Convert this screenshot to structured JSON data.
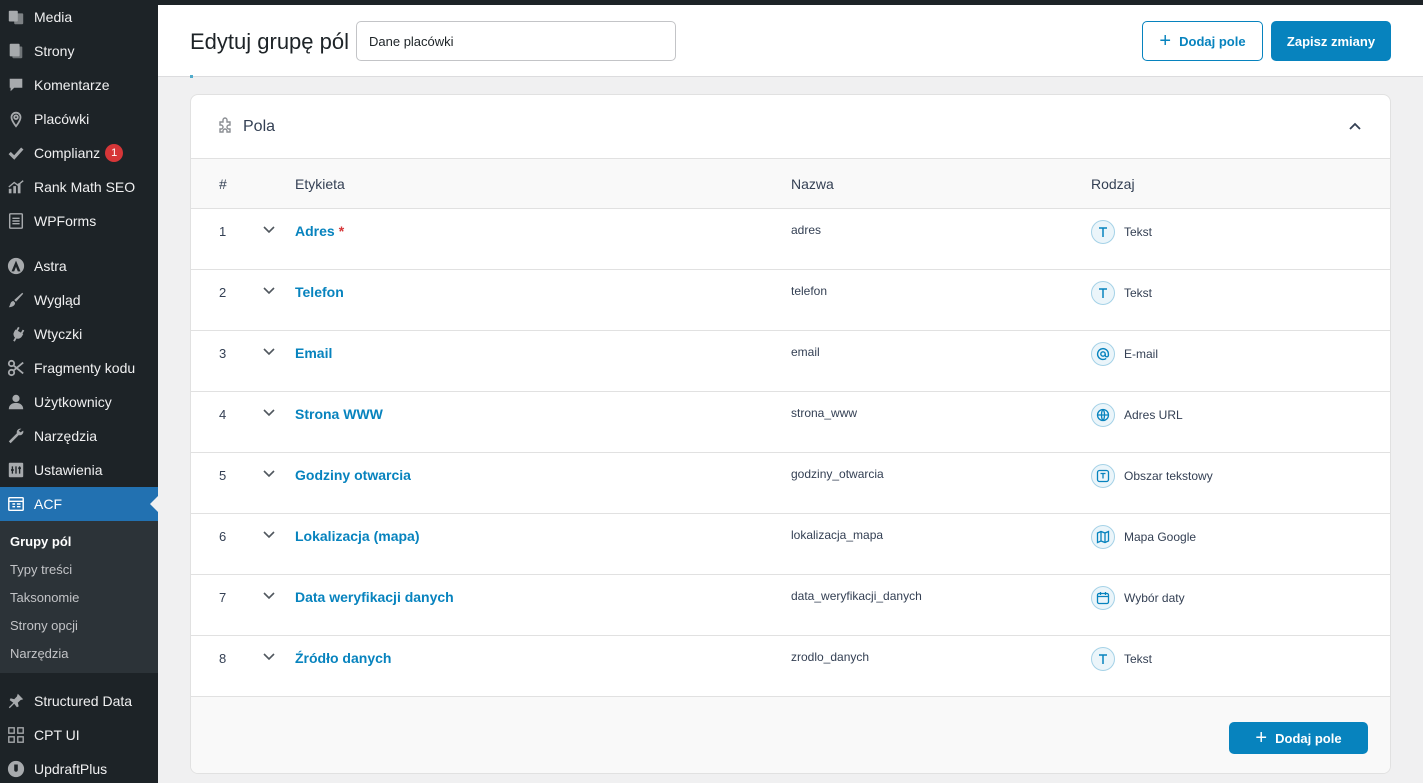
{
  "sidebar": {
    "items": [
      {
        "label": "Media",
        "icon": "media-icon"
      },
      {
        "label": "Strony",
        "icon": "pages-icon"
      },
      {
        "label": "Komentarze",
        "icon": "comments-icon"
      },
      {
        "label": "Placówki",
        "icon": "location-pin-icon"
      },
      {
        "label": "Complianz",
        "icon": "checkmark-icon",
        "badge": "1"
      },
      {
        "label": "Rank Math SEO",
        "icon": "chart-icon"
      },
      {
        "label": "WPForms",
        "icon": "forms-icon"
      },
      {
        "label": "Astra",
        "icon": "astra-icon"
      },
      {
        "label": "Wygląd",
        "icon": "paintbrush-icon"
      },
      {
        "label": "Wtyczki",
        "icon": "plugin-icon"
      },
      {
        "label": "Fragmenty kodu",
        "icon": "scissors-icon"
      },
      {
        "label": "Użytkownicy",
        "icon": "user-icon"
      },
      {
        "label": "Narzędzia",
        "icon": "wrench-icon"
      },
      {
        "label": "Ustawienia",
        "icon": "settings-icon"
      },
      {
        "label": "ACF",
        "icon": "acf-icon"
      },
      {
        "label": "Structured Data",
        "icon": "pin-icon"
      },
      {
        "label": "CPT UI",
        "icon": "grid-icon"
      },
      {
        "label": "UpdraftPlus",
        "icon": "updraft-icon"
      }
    ],
    "submenu": [
      "Grupy pól",
      "Typy treści",
      "Taksonomie",
      "Strony opcji",
      "Narzędzia"
    ]
  },
  "header": {
    "title": "Edytuj grupę pól",
    "group_name": "Dane placówki",
    "add_field_label": "Dodaj pole",
    "save_label": "Zapisz zmiany"
  },
  "card": {
    "title": "Pola",
    "columns": {
      "num": "#",
      "label": "Etykieta",
      "name": "Nazwa",
      "type": "Rodzaj"
    },
    "rows": [
      {
        "num": "1",
        "label": "Adres",
        "required": "*",
        "name": "adres",
        "type": "Tekst",
        "type_icon": "text-type-icon"
      },
      {
        "num": "2",
        "label": "Telefon",
        "required": "",
        "name": "telefon",
        "type": "Tekst",
        "type_icon": "text-type-icon"
      },
      {
        "num": "3",
        "label": "Email",
        "required": "",
        "name": "email",
        "type": "E-mail",
        "type_icon": "email-type-icon"
      },
      {
        "num": "4",
        "label": "Strona WWW",
        "required": "",
        "name": "strona_www",
        "type": "Adres URL",
        "type_icon": "globe-type-icon"
      },
      {
        "num": "5",
        "label": "Godziny otwarcia",
        "required": "",
        "name": "godziny_otwarcia",
        "type": "Obszar tekstowy",
        "type_icon": "textarea-type-icon"
      },
      {
        "num": "6",
        "label": "Lokalizacja (mapa)",
        "required": "",
        "name": "lokalizacja_mapa",
        "type": "Mapa Google",
        "type_icon": "map-type-icon"
      },
      {
        "num": "7",
        "label": "Data weryfikacji danych",
        "required": "",
        "name": "data_weryfikacji_danych",
        "type": "Wybór daty",
        "type_icon": "calendar-type-icon"
      },
      {
        "num": "8",
        "label": "Źródło danych",
        "required": "",
        "name": "zrodlo_danych",
        "type": "Tekst",
        "type_icon": "text-type-icon"
      }
    ],
    "footer_add_label": "Dodaj pole"
  },
  "colors": {
    "accent": "#0783be",
    "sidebar_bg": "#1d2327",
    "active_menu": "#2271b1",
    "badge": "#d63638"
  }
}
